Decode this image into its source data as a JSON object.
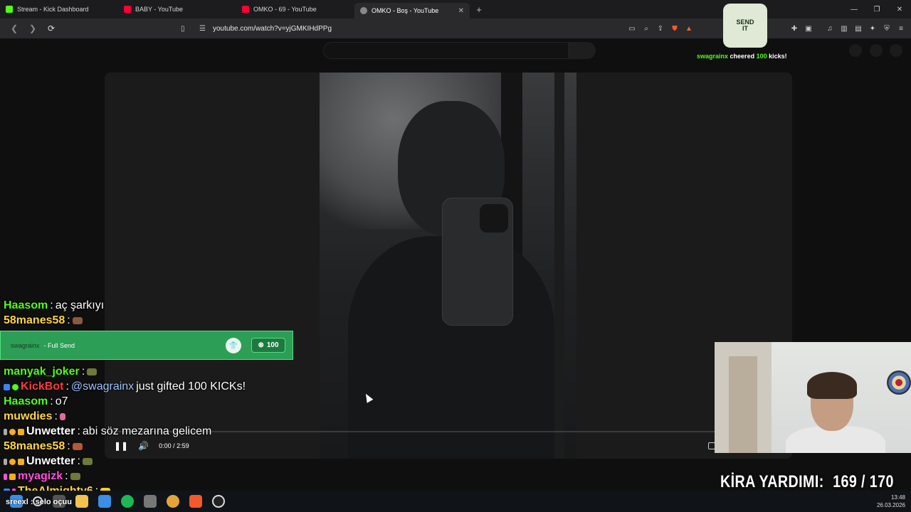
{
  "browser": {
    "tabs": [
      {
        "label": "Stream - Kick Dashboard",
        "color": "#53fc18",
        "active": false
      },
      {
        "label": "BABY - YouTube",
        "color": "#ff0033",
        "active": false
      },
      {
        "label": "OMKO - 69 - YouTube",
        "color": "#ff0033",
        "active": false
      },
      {
        "label": "OMKO - Boş - YouTube",
        "color": "#888888",
        "active": true
      }
    ],
    "url": "youtube.com/watch?v=yjGMKIHdPPg"
  },
  "player": {
    "time": "0:00 / 2:59"
  },
  "cheer": {
    "user": "swagrainx",
    "text": "cheered",
    "amount": "100",
    "unit": "kicks!",
    "sticker_line1": "SEND",
    "sticker_line2": "IT"
  },
  "chat": {
    "messages": [
      {
        "user": "Haasom",
        "color": "#53fc18",
        "text": "aç şarkıyı"
      },
      {
        "user": "58manes58",
        "color": "#ffd54a",
        "text": ""
      },
      {
        "user": "manyak_joker",
        "color": "#53fc18",
        "text": ""
      },
      {
        "user": "KickBot",
        "color": "#ff3b3b",
        "text": "@swagrainx",
        "text2": "just gifted 100 KICKs!"
      },
      {
        "user": "Haasom",
        "color": "#53fc18",
        "text": "o7"
      },
      {
        "user": "muwdies",
        "color": "#ffd54a",
        "text": ""
      },
      {
        "user": "Unwetter",
        "color": "#ffffff",
        "text": "abi söz mezarına gelicem"
      },
      {
        "user": "58manes58",
        "color": "#ffd54a",
        "text": ""
      },
      {
        "user": "Unwetter",
        "color": "#ffffff",
        "text": ""
      },
      {
        "user": "myagizk",
        "color": "#ff4fd8",
        "text": ""
      },
      {
        "user": "TheAlmighty6",
        "color": "#ffd54a",
        "text": ""
      }
    ],
    "bottom_line": "sreexl : selo oçuu"
  },
  "fullsend": {
    "user": "swagrainx",
    "label": "- Full Send",
    "amount": "100"
  },
  "kira": {
    "label": "KİRA YARDIMI:",
    "value": "169 / 170"
  },
  "taskbar": {
    "time": "13:48",
    "date": "26.03.2026"
  }
}
